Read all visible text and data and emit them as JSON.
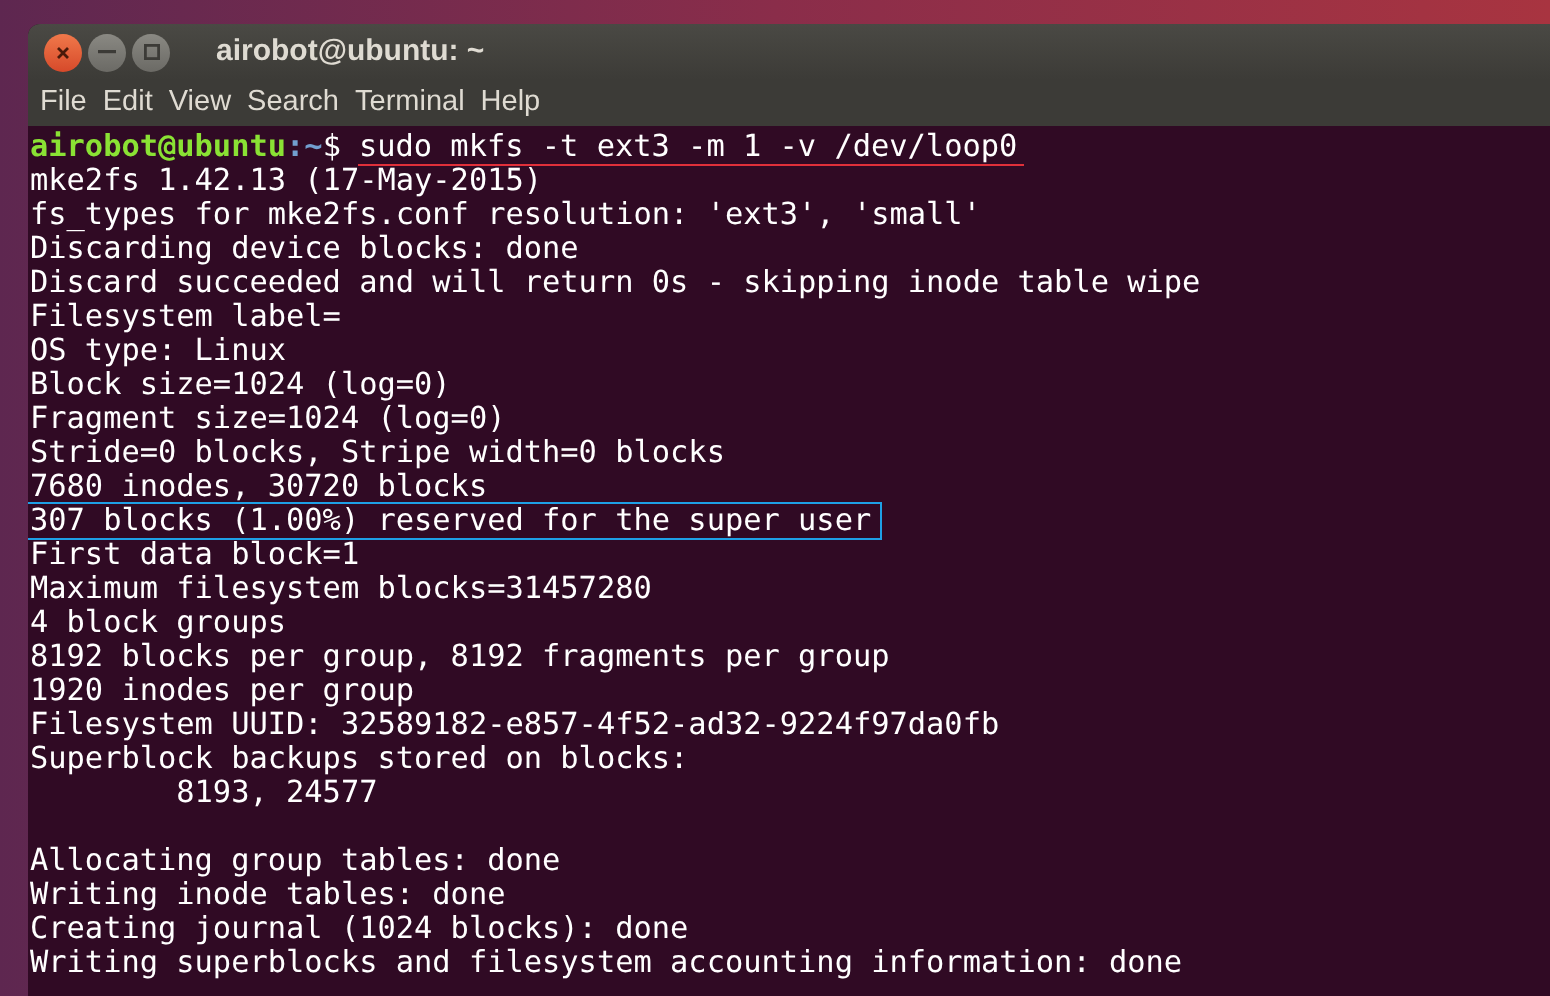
{
  "window": {
    "title": "airobot@ubuntu: ~"
  },
  "menu": [
    "File",
    "Edit",
    "View",
    "Search",
    "Terminal",
    "Help"
  ],
  "terminal": {
    "lines": [
      {
        "kind": "prompt",
        "user": "airobot@ubuntu",
        "path": ":~",
        "symbol": "$",
        "command": "sudo mkfs -t ext3 -m 1 -v /dev/loop0",
        "underlined": true
      },
      {
        "kind": "output",
        "text": "mke2fs 1.42.13 (17-May-2015)",
        "marked": false
      },
      {
        "kind": "output",
        "text": "fs_types for mke2fs.conf resolution: 'ext3', 'small'",
        "marked": false
      },
      {
        "kind": "output",
        "text": "Discarding device blocks: done",
        "marked": false
      },
      {
        "kind": "output",
        "text": "Discard succeeded and will return 0s - skipping inode table wipe",
        "marked": false
      },
      {
        "kind": "output",
        "text": "Filesystem label=",
        "marked": false
      },
      {
        "kind": "output",
        "text": "OS type: Linux",
        "marked": false
      },
      {
        "kind": "output",
        "text": "Block size=1024 (log=0)",
        "marked": false
      },
      {
        "kind": "output",
        "text": "Fragment size=1024 (log=0)",
        "marked": false
      },
      {
        "kind": "output",
        "text": "Stride=0 blocks, Stripe width=0 blocks",
        "marked": false
      },
      {
        "kind": "output",
        "text": "7680 inodes, 30720 blocks",
        "marked": false
      },
      {
        "kind": "output",
        "text": "307 blocks (1.00%) reserved for the super user",
        "marked": true
      },
      {
        "kind": "output",
        "text": "First data block=1",
        "marked": false
      },
      {
        "kind": "output",
        "text": "Maximum filesystem blocks=31457280",
        "marked": false
      },
      {
        "kind": "output",
        "text": "4 block groups",
        "marked": false
      },
      {
        "kind": "output",
        "text": "8192 blocks per group, 8192 fragments per group",
        "marked": false
      },
      {
        "kind": "output",
        "text": "1920 inodes per group",
        "marked": false
      },
      {
        "kind": "output",
        "text": "Filesystem UUID: 32589182-e857-4f52-ad32-9224f97da0fb",
        "marked": false
      },
      {
        "kind": "output",
        "text": "Superblock backups stored on blocks:",
        "marked": false
      },
      {
        "kind": "output",
        "text": "        8193, 24577",
        "marked": false
      },
      {
        "kind": "blank"
      },
      {
        "kind": "output",
        "text": "Allocating group tables: done",
        "marked": false
      },
      {
        "kind": "output",
        "text": "Writing inode tables: done",
        "marked": false
      },
      {
        "kind": "output",
        "text": "Creating journal (1024 blocks): done",
        "marked": false
      },
      {
        "kind": "output",
        "text": "Writing superblocks and filesystem accounting information: done",
        "marked": false
      }
    ]
  }
}
